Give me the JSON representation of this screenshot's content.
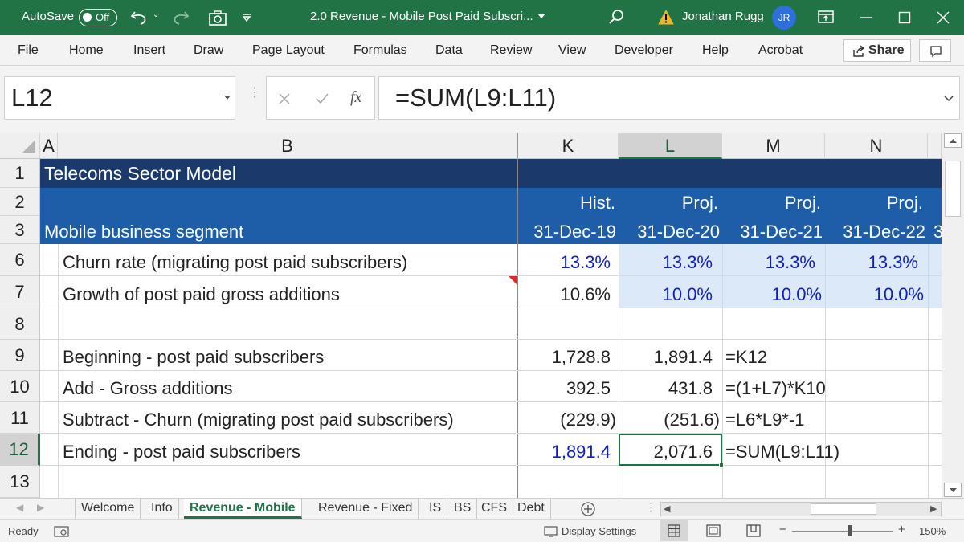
{
  "titlebar": {
    "autosave_label": "AutoSave",
    "autosave_state": "Off",
    "document_title": "2.0 Revenue - Mobile Post Paid Subscri...",
    "user_name": "Jonathan Rugg",
    "user_initials": "JR"
  },
  "menu": [
    "File",
    "Home",
    "Insert",
    "Draw",
    "Page Layout",
    "Formulas",
    "Data",
    "Review",
    "View",
    "Developer",
    "Help",
    "Acrobat"
  ],
  "share_label": "Share",
  "formula_bar": {
    "name_box": "L12",
    "fx": "fx",
    "formula": "=SUM(L9:L11)"
  },
  "columns": [
    "A",
    "B",
    "K",
    "L",
    "M",
    "N"
  ],
  "selected_column": "L",
  "row_numbers": [
    "1",
    "2",
    "3",
    "6",
    "7",
    "8",
    "9",
    "10",
    "11",
    "12",
    "13"
  ],
  "selected_row": "12",
  "sheet": {
    "title": "Telecoms Sector Model",
    "segment": "Mobile business segment",
    "period_types": [
      "Hist.",
      "Proj.",
      "Proj.",
      "Proj."
    ],
    "dates": [
      "31-Dec-19",
      "31-Dec-20",
      "31-Dec-21",
      "31-Dec-22"
    ],
    "date_overflow": "3",
    "rows": [
      {
        "label": "Churn rate (migrating post paid subscribers)",
        "values": [
          "13.3%",
          "13.3%",
          "13.3%",
          "13.3%"
        ]
      },
      {
        "label": "Growth of post paid gross additions",
        "values": [
          "10.6%",
          "10.0%",
          "10.0%",
          "10.0%"
        ]
      },
      {
        "label": "",
        "values": [
          "",
          "",
          "",
          ""
        ]
      },
      {
        "label": "Beginning - post paid subscribers",
        "values": [
          "1,728.8",
          "1,891.4",
          "=K12",
          ""
        ]
      },
      {
        "label": "Add  - Gross additions",
        "values": [
          "392.5",
          "431.8",
          "=(1+L7)*K10",
          ""
        ]
      },
      {
        "label": "Subtract - Churn (migrating post paid subscribers)",
        "values": [
          "(229.9)",
          "(251.6)",
          "=L6*L9*-1",
          ""
        ]
      },
      {
        "label": "Ending - post paid subscribers",
        "values": [
          "1,891.4",
          "2,071.6",
          "=SUM(L9:L11)",
          ""
        ]
      }
    ]
  },
  "sheet_tabs": [
    "Welcome",
    "Info",
    "Revenue - Mobile",
    "Revenue - Fixed",
    "IS",
    "BS",
    "CFS",
    "Debt"
  ],
  "active_tab": "Revenue - Mobile",
  "status": {
    "ready": "Ready",
    "display_settings": "Display Settings",
    "zoom": "150%"
  },
  "colors": {
    "excel_green": "#217346",
    "title_band": "#1b3a6b",
    "header_band": "#1e5da8",
    "input_fill": "#dbe9f8",
    "input_font": "#0f1fbf"
  },
  "icons": [
    "undo-icon",
    "redo-icon",
    "camera-icon",
    "customize-qat-icon",
    "search-icon",
    "warning-icon",
    "ribbon-display-icon",
    "minimize-icon",
    "maximize-icon",
    "close-icon",
    "share-icon",
    "comment-icon",
    "cancel-icon",
    "enter-icon",
    "add-sheet-icon",
    "normal-view-icon",
    "page-layout-view-icon",
    "page-break-view-icon"
  ]
}
